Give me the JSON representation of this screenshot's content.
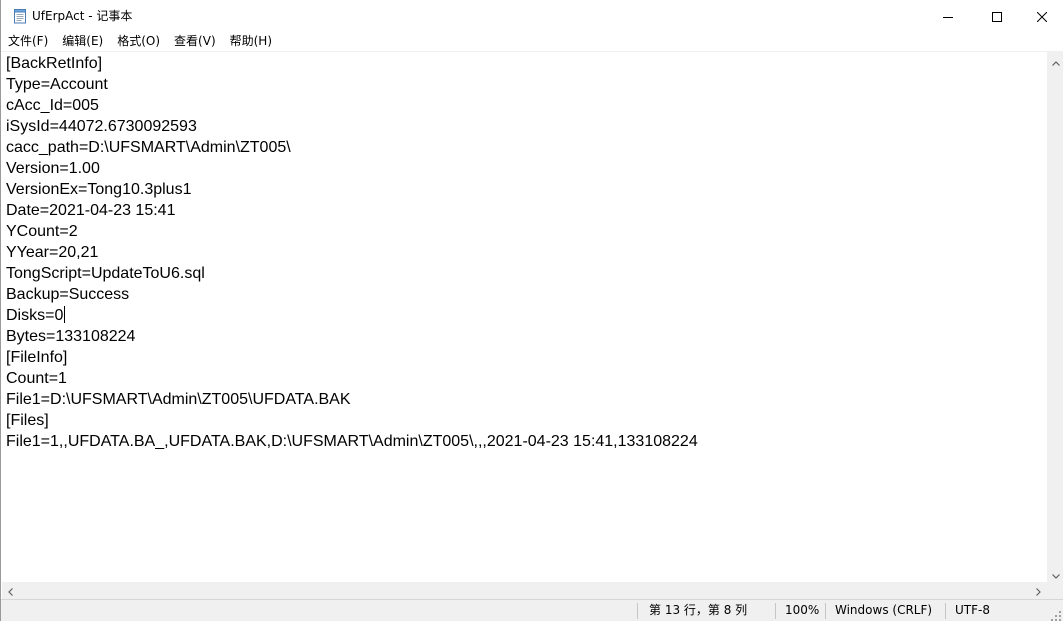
{
  "window": {
    "title": "UfErpAct - 记事本"
  },
  "menu": [
    {
      "label": "文件(F)"
    },
    {
      "label": "编辑(E)"
    },
    {
      "label": "格式(O)"
    },
    {
      "label": "查看(V)"
    },
    {
      "label": "帮助(H)"
    }
  ],
  "editor": {
    "lines": [
      "[BackRetInfo]",
      "Type=Account",
      "cAcc_Id=005",
      "iSysId=44072.6730092593",
      "cacc_path=D:\\UFSMART\\Admin\\ZT005\\",
      "Version=1.00",
      "VersionEx=Tong10.3plus1",
      "Date=2021-04-23 15:41",
      "YCount=2",
      "YYear=20,21",
      "TongScript=UpdateToU6.sql",
      "Backup=Success",
      "Disks=0",
      "Bytes=133108224",
      "[FileInfo]",
      "Count=1",
      "File1=D:\\UFSMART\\Admin\\ZT005\\UFDATA.BAK",
      "[Files]",
      "File1=1,,UFDATA.BA_,UFDATA.BAK,D:\\UFSMART\\Admin\\ZT005\\,,,2021-04-23 15:41,133108224"
    ]
  },
  "statusbar": {
    "position": "第 13 行，第 8 列",
    "zoom": "100%",
    "line_ending": "Windows (CRLF)",
    "encoding": "UTF-8"
  },
  "icons": {
    "app": "notepad-icon",
    "minimize": "minimize-icon",
    "maximize": "maximize-icon",
    "close": "close-icon",
    "scroll_up": "chevron-up-icon",
    "scroll_down": "chevron-down-icon",
    "scroll_left": "chevron-left-icon",
    "scroll_right": "chevron-right-icon",
    "grip": "resize-grip-icon"
  }
}
